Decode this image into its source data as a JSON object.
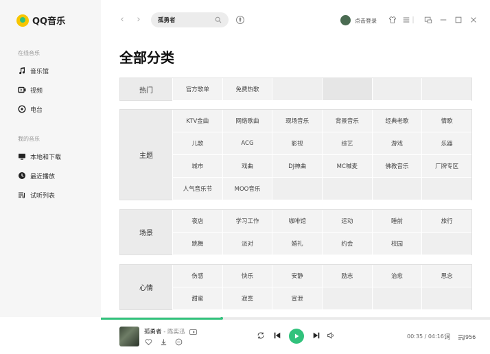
{
  "app": {
    "name": "QQ音乐"
  },
  "sidebar": {
    "online_title": "在线音乐",
    "online_items": [
      {
        "label": "音乐馆",
        "icon": "music-note-icon"
      },
      {
        "label": "视频",
        "icon": "video-icon"
      },
      {
        "label": "电台",
        "icon": "radio-icon"
      }
    ],
    "mine_title": "我的音乐",
    "mine_items": [
      {
        "label": "本地和下载",
        "icon": "computer-icon"
      },
      {
        "label": "最近播放",
        "icon": "clock-icon"
      },
      {
        "label": "试听列表",
        "icon": "playlist-icon"
      }
    ]
  },
  "topbar": {
    "back": "‹",
    "forward": "›",
    "search_value": "孤勇者",
    "login_label": "点击登录"
  },
  "page": {
    "title": "全部分类"
  },
  "groups": [
    {
      "label": "热门",
      "items": [
        "官方歌单",
        "免费热歌",
        "",
        "",
        "",
        ""
      ]
    },
    {
      "label": "主题",
      "items": [
        "KTV金曲",
        "网络歌曲",
        "现场音乐",
        "背景音乐",
        "经典老歌",
        "情歌",
        "儿歌",
        "ACG",
        "影视",
        "综艺",
        "游戏",
        "乐器",
        "城市",
        "戏曲",
        "DJ神曲",
        "MC喊麦",
        "佛教音乐",
        "厂牌专区",
        "人气音乐节",
        "MOO音乐",
        "",
        "",
        "",
        ""
      ]
    },
    {
      "label": "场景",
      "items": [
        "夜店",
        "学习工作",
        "咖啡馆",
        "运动",
        "睡前",
        "旅行",
        "跳舞",
        "派对",
        "婚礼",
        "约会",
        "校园",
        ""
      ]
    },
    {
      "label": "心情",
      "items": [
        "伤感",
        "快乐",
        "安静",
        "励志",
        "治愈",
        "思念",
        "甜蜜",
        "寂寞",
        "宣泄",
        "",
        "",
        ""
      ]
    }
  ],
  "player": {
    "song": "孤勇者",
    "separator": " - ",
    "artist": "陈奕迅",
    "progress": 0.31,
    "time": "00:35 / 04:16",
    "lyric_label": "词",
    "playlist_count": "956"
  },
  "colors": {
    "accent": "#31c27c",
    "sidebar_bg": "#f6f6f6"
  }
}
